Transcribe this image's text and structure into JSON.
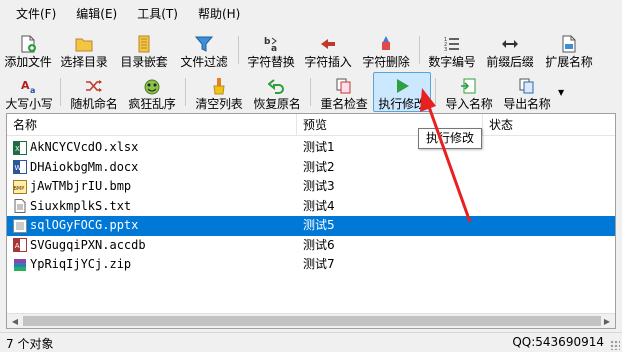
{
  "menu": [
    {
      "label": "文件(F)",
      "name": "menu-file"
    },
    {
      "label": "编辑(E)",
      "name": "menu-edit"
    },
    {
      "label": "工具(T)",
      "name": "menu-tools"
    },
    {
      "label": "帮助(H)",
      "name": "menu-help"
    }
  ],
  "toolbar1": [
    {
      "label": "添加文件",
      "name": "add-file-button",
      "icon": "add-file-icon"
    },
    {
      "label": "选择目录",
      "name": "select-folder-button",
      "icon": "folder-icon"
    },
    {
      "label": "目录嵌套",
      "name": "nested-folder-button",
      "icon": "nested-folder-icon"
    },
    {
      "label": "文件过滤",
      "name": "filter-button",
      "icon": "filter-icon"
    },
    {
      "label": "字符替换",
      "name": "replace-chars-button",
      "icon": "replace-icon"
    },
    {
      "label": "字符插入",
      "name": "insert-chars-button",
      "icon": "insert-icon"
    },
    {
      "label": "字符删除",
      "name": "delete-chars-button",
      "icon": "eraser-icon"
    },
    {
      "label": "数字编号",
      "name": "numbering-button",
      "icon": "numbered-list-icon"
    },
    {
      "label": "前缀后缀",
      "name": "prefix-suffix-button",
      "icon": "arrows-horizontal-icon"
    },
    {
      "label": "扩展名称",
      "name": "extension-button",
      "icon": "file-ext-icon"
    }
  ],
  "toolbar2": [
    {
      "label": "大写小写",
      "name": "case-button",
      "icon": "case-icon"
    },
    {
      "label": "随机命名",
      "name": "random-name-button",
      "icon": "shuffle-icon"
    },
    {
      "label": "疯狂乱序",
      "name": "crazy-shuffle-button",
      "icon": "crazy-face-icon"
    },
    {
      "label": "清空列表",
      "name": "clear-list-button",
      "icon": "broom-icon"
    },
    {
      "label": "恢复原名",
      "name": "restore-name-button",
      "icon": "undo-icon"
    },
    {
      "label": "重名检查",
      "name": "duplicate-check-button",
      "icon": "duplicate-icon"
    },
    {
      "label": "执行修改",
      "name": "execute-button",
      "icon": "play-icon"
    },
    {
      "label": "导入名称",
      "name": "import-names-button",
      "icon": "import-icon"
    },
    {
      "label": "导出名称",
      "name": "export-names-button",
      "icon": "export-icon"
    }
  ],
  "list": {
    "headers": [
      "名称",
      "预览",
      "状态"
    ],
    "rows": [
      {
        "name": "AkNCYCVcdO.xlsx",
        "preview": "测试1",
        "icon": "excel-file-icon",
        "selected": false
      },
      {
        "name": "DHAiokbgMm.docx",
        "preview": "测试2",
        "icon": "word-file-icon",
        "selected": false
      },
      {
        "name": "jAwTMbjrIU.bmp",
        "preview": "测试3",
        "icon": "bmp-file-icon",
        "selected": false
      },
      {
        "name": "SiuxkmplkS.txt",
        "preview": "测试4",
        "icon": "text-file-icon",
        "selected": false
      },
      {
        "name": "sqlOGyFOCG.pptx",
        "preview": "测试5",
        "icon": "ppt-file-icon",
        "selected": true
      },
      {
        "name": "SVGugqiPXN.accdb",
        "preview": "测试6",
        "icon": "access-file-icon",
        "selected": false
      },
      {
        "name": "YpRiqIjYCj.zip",
        "preview": "测试7",
        "icon": "zip-file-icon",
        "selected": false
      }
    ]
  },
  "tooltip": "执行修改",
  "status": {
    "count": "7 个对象",
    "contact": "QQ:543690914"
  },
  "colors": {
    "selection": "#0078d7",
    "active_button": "#cce8ff",
    "annotation_arrow": "#e82020"
  }
}
